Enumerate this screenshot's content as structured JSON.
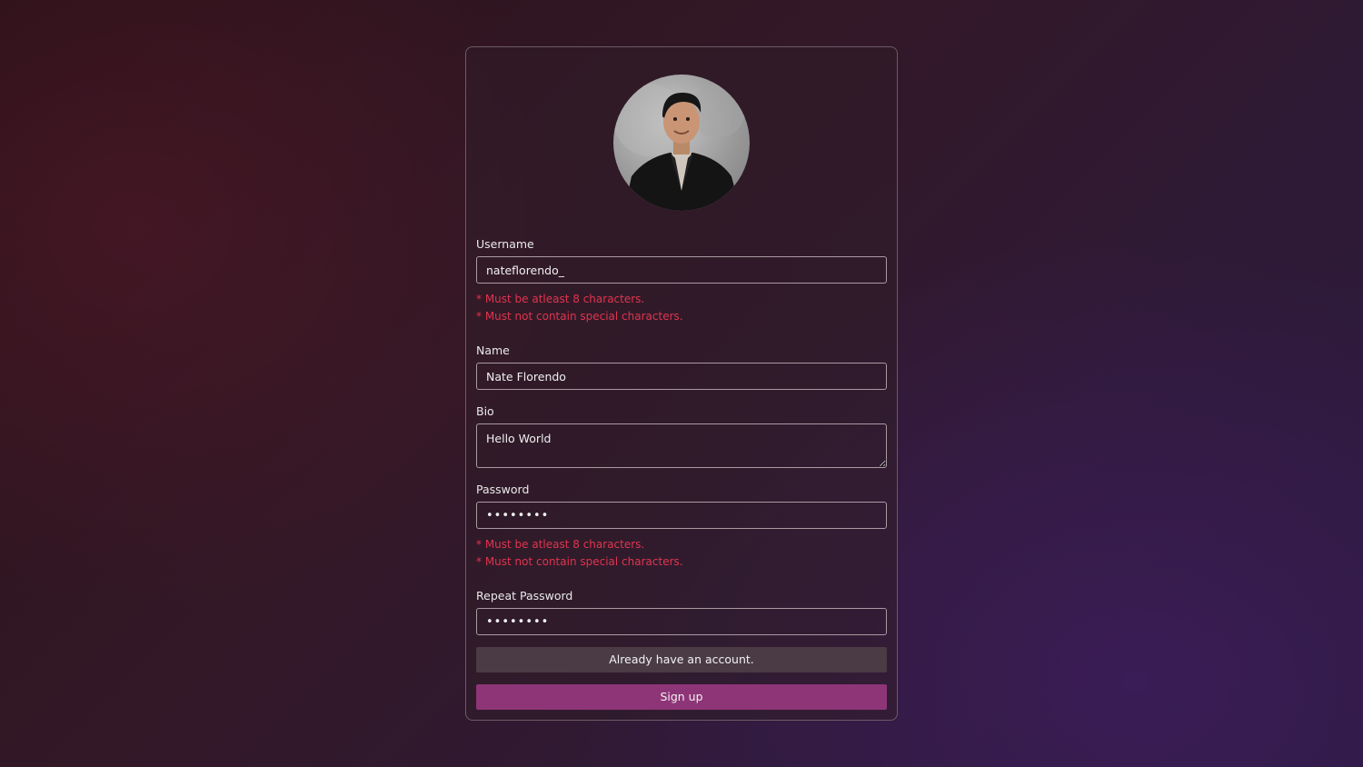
{
  "avatar": {
    "alt": "Profile photo"
  },
  "form": {
    "username": {
      "label": "Username",
      "value": "natefl orendo_",
      "errors": [
        "* Must be atleast 8 characters.",
        "* Must not contain special characters."
      ]
    },
    "name": {
      "label": "Name",
      "value": "Nate Florendo"
    },
    "bio": {
      "label": "Bio",
      "value": "Hello World"
    },
    "password": {
      "label": "Password",
      "value": "••••••••",
      "errors": [
        "* Must be atleast 8 characters.",
        "* Must not contain special characters."
      ]
    },
    "repeat_password": {
      "label": "Repeat Password",
      "value": "••••••••"
    }
  },
  "buttons": {
    "login": "Already have an account.",
    "signup": "Sign up"
  },
  "colors": {
    "error": "#e0344f",
    "primary_button": "#8e3577",
    "secondary_button": "#4a3b44"
  }
}
